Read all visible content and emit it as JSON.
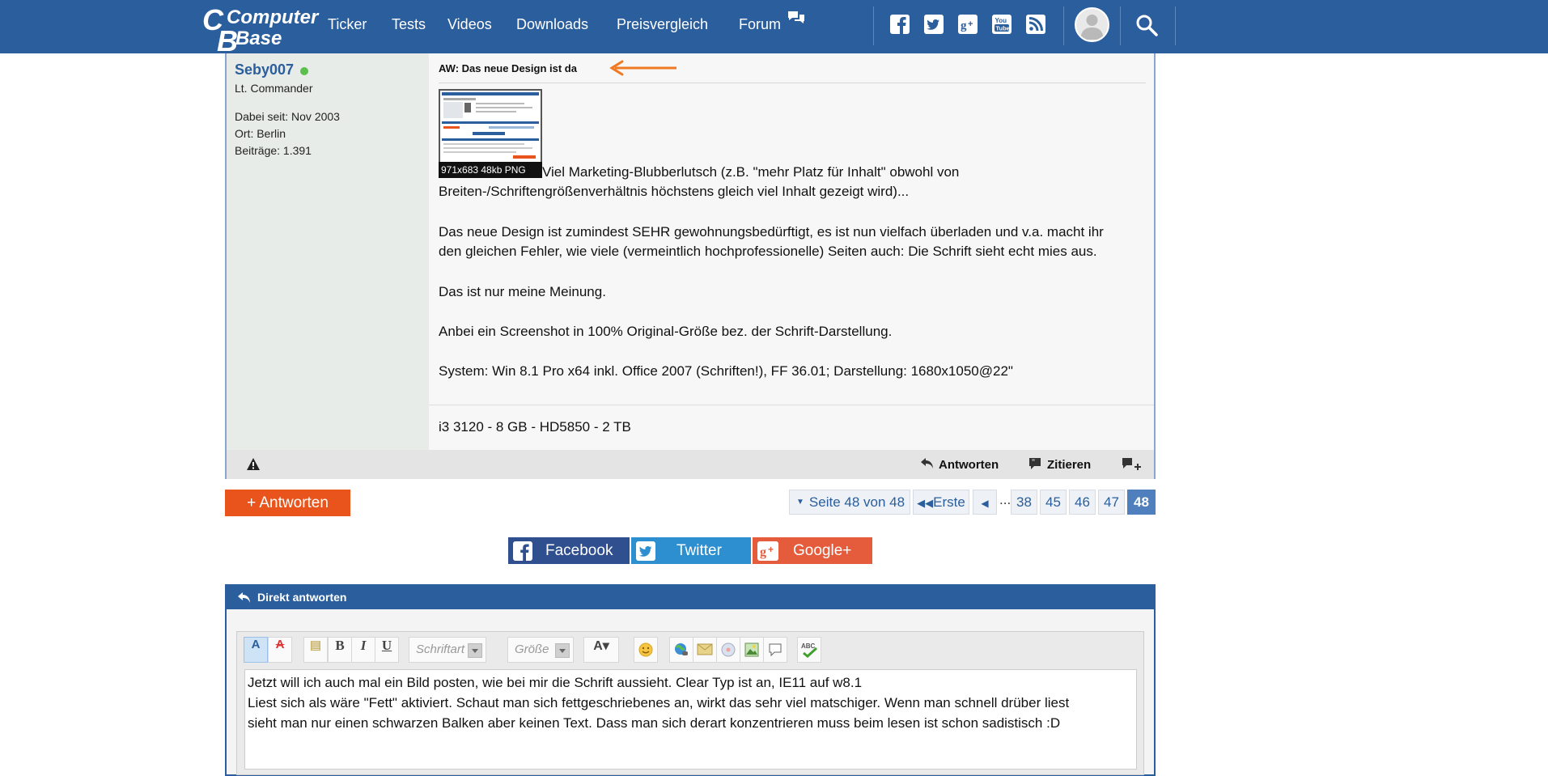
{
  "header": {
    "logo_text_1": "Computer",
    "logo_text_2": "Base",
    "nav": [
      "Ticker",
      "Tests",
      "Videos",
      "Downloads",
      "Preisvergleich",
      "Forum"
    ],
    "social_icons": [
      "facebook-icon",
      "twitter-icon",
      "google-plus-icon",
      "youtube-icon",
      "rss-icon"
    ],
    "colors": {
      "bar": "#2b5e9c"
    }
  },
  "post": {
    "author": "Seby007",
    "rank": "Lt. Commander",
    "joined": "Dabei seit: Nov 2003",
    "location": "Ort: Berlin",
    "posts": "Beiträge: 1.391",
    "title": "AW: Das neue Design ist da",
    "thumb_caption": "971x683 48kb PNG",
    "paragraphs": [
      "Viel Marketing-Blubberlutsch (z.B. \"mehr Platz für Inhalt\" obwohl von",
      "Breiten-/Schriftengrößenverhältnis höchstens gleich viel Inhalt gezeigt wird)...",
      "Das neue Design ist zumindest SEHR gewohnungsbedürftigt, es ist nun vielfach überladen und v.a. macht ihr",
      "den gleichen Fehler, wie viele (vermeintlich hochprofessionelle) Seiten auch: Die Schrift sieht echt mies aus.",
      "Das ist nur meine Meinung.",
      "Anbei ein Screenshot in 100% Original-Größe bez. der Schrift-Darstellung.",
      "System: Win 8.1 Pro x64 inkl. Office 2007 (Schriften!), FF 36.01; Darstellung: 1680x1050@22\""
    ],
    "signature": "i3 3120 - 8 GB - HD5850 - 2 TB",
    "actions": {
      "reply": "Antworten",
      "quote": "Zitieren"
    }
  },
  "reply_button": "+ Antworten",
  "pagination": {
    "page_info": "Seite 48 von 48",
    "first": "Erste",
    "dots": "...",
    "pages": [
      "38",
      "45",
      "46",
      "47",
      "48"
    ],
    "current": "48"
  },
  "share": {
    "facebook": "Facebook",
    "twitter": "Twitter",
    "google": "Google+"
  },
  "direct_reply": {
    "title": "Direkt antworten",
    "font_placeholder": "Schriftart",
    "size_placeholder": "Größe",
    "text_lines": [
      "Jetzt will ich auch mal ein Bild posten, wie bei mir die Schrift aussieht. Clear Typ ist an, IE11 auf w8.1",
      "Liest sich als wäre \"Fett\" aktiviert. Schaut man sich fettgeschriebenes an, wirkt das sehr viel matschiger. Wenn man schnell drüber liest",
      "sieht man nur einen schwarzen Balken aber keinen Text. Dass man sich derart konzentrieren muss beim lesen ist schon sadistisch :D"
    ]
  }
}
